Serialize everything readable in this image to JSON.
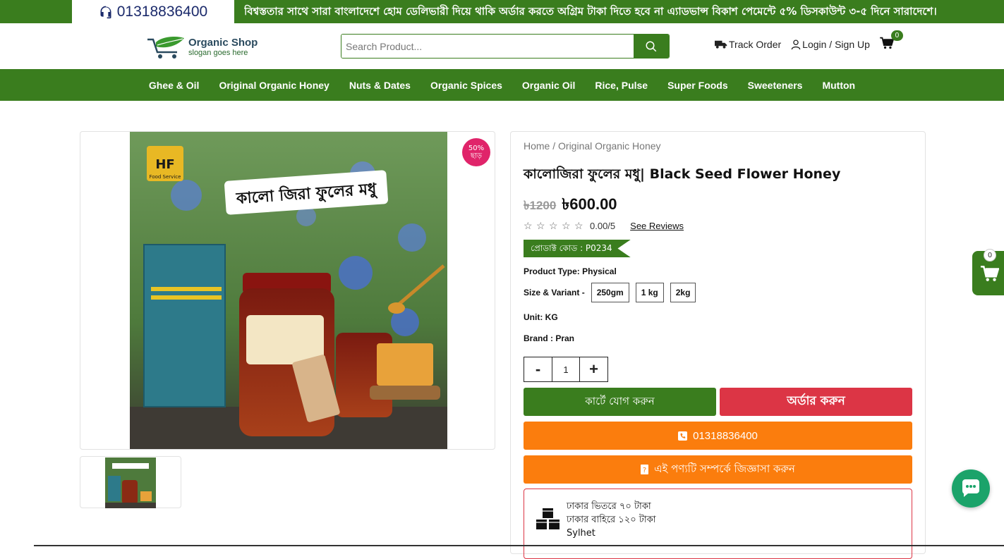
{
  "topbar": {
    "phone": "01318836400",
    "marquee": "বিশ্বস্ততার সাথে সারা বাংলাদেশে হোম ডেলিভারী দিয়ে থাকি অর্ডার করতে অগ্রিম টাকা দিতে হবে না এ্যাডভান্স বিকাশ পেমেন্টে ৫% ডিসকাউন্ট ৩-৫ দিনে সারাদেশে।"
  },
  "header": {
    "logo_name": "Organic Shop",
    "logo_slogan": "slogan goes here",
    "search_placeholder": "Search Product...",
    "track_order": "Track Order",
    "login": "Login / Sign Up",
    "cart_count": "0"
  },
  "nav": {
    "items": [
      "Ghee & Oil",
      "Original Organic Honey",
      "Nuts & Dates",
      "Organic Spices",
      "Organic Oil",
      "Rice, Pulse",
      "Super Foods",
      "Sweeteners",
      "Mutton"
    ]
  },
  "gallery": {
    "discount_pct": "50%",
    "discount_word": "ছাড়",
    "image_label": "কালো জিরা ফুলের মধু",
    "brand_mark": "Food Service"
  },
  "product": {
    "breadcrumb": "Home / Original Organic Honey",
    "title": "কালোজিরা ফুলের মধু| Black Seed Flower Honey",
    "old_price": "৳1200",
    "new_price": "৳600.00",
    "rating": "0.00/5",
    "see_reviews": "See Reviews",
    "code": "প্রোডাক্ট কোড : P0234",
    "product_type": "Product Type: Physical",
    "variant_label": "Size & Variant -",
    "variants": [
      "250gm",
      "1 kg",
      "2kg"
    ],
    "unit": "Unit: KG",
    "brand": "Brand : Pran",
    "qty_minus": "-",
    "qty_value": "1",
    "qty_plus": "+",
    "add_to_cart": "কার্টে যোগ করুন",
    "order_now": "অর্ডার করুন",
    "phone_button": "01318836400",
    "ask_button": "এই পণ্যটি সম্পর্কে জিজ্ঞাসা করুন",
    "delivery_inside": "ঢাকার ভিতরে ৭০ টাকা",
    "delivery_outside": "ঢাকার বাহিরে ১২০ টাকা",
    "delivery_city": "Sylhet"
  },
  "side_cart": {
    "count": "0"
  },
  "colors": {
    "primary_green": "#3a7d1e",
    "order_red": "#dc3545",
    "orange": "#fb7d0d",
    "badge_pink": "#e0246a",
    "chat_green": "#1ba36a"
  }
}
